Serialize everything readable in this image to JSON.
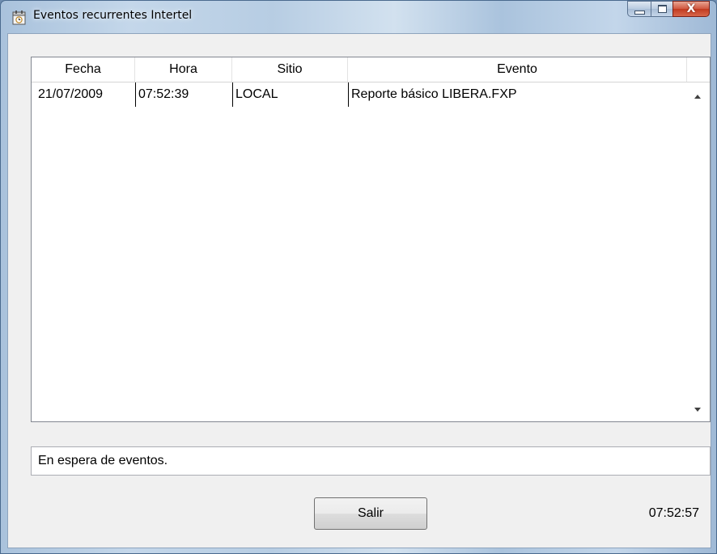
{
  "window": {
    "title": "Eventos recurrentes Intertel",
    "controls": {
      "minimize": "minimize",
      "maximize": "maximize",
      "close": "X"
    }
  },
  "grid": {
    "columns": [
      "Fecha",
      "Hora",
      "Sitio",
      "Evento"
    ],
    "rows": [
      {
        "fecha": "21/07/2009",
        "hora": "07:52:39",
        "sitio": "LOCAL",
        "evento": "Reporte básico LIBERA.FXP"
      }
    ]
  },
  "status": {
    "message": "En espera de eventos."
  },
  "footer": {
    "exit_label": "Salir",
    "clock": "07:52:57"
  },
  "icons": {
    "app": "calendar-clock-icon",
    "scroll_up": "arrow-up-icon",
    "scroll_down": "arrow-down-icon"
  },
  "colors": {
    "close_button": "#c13a20",
    "titlebar": "#b7cde3",
    "client": "#f0f0f0"
  }
}
